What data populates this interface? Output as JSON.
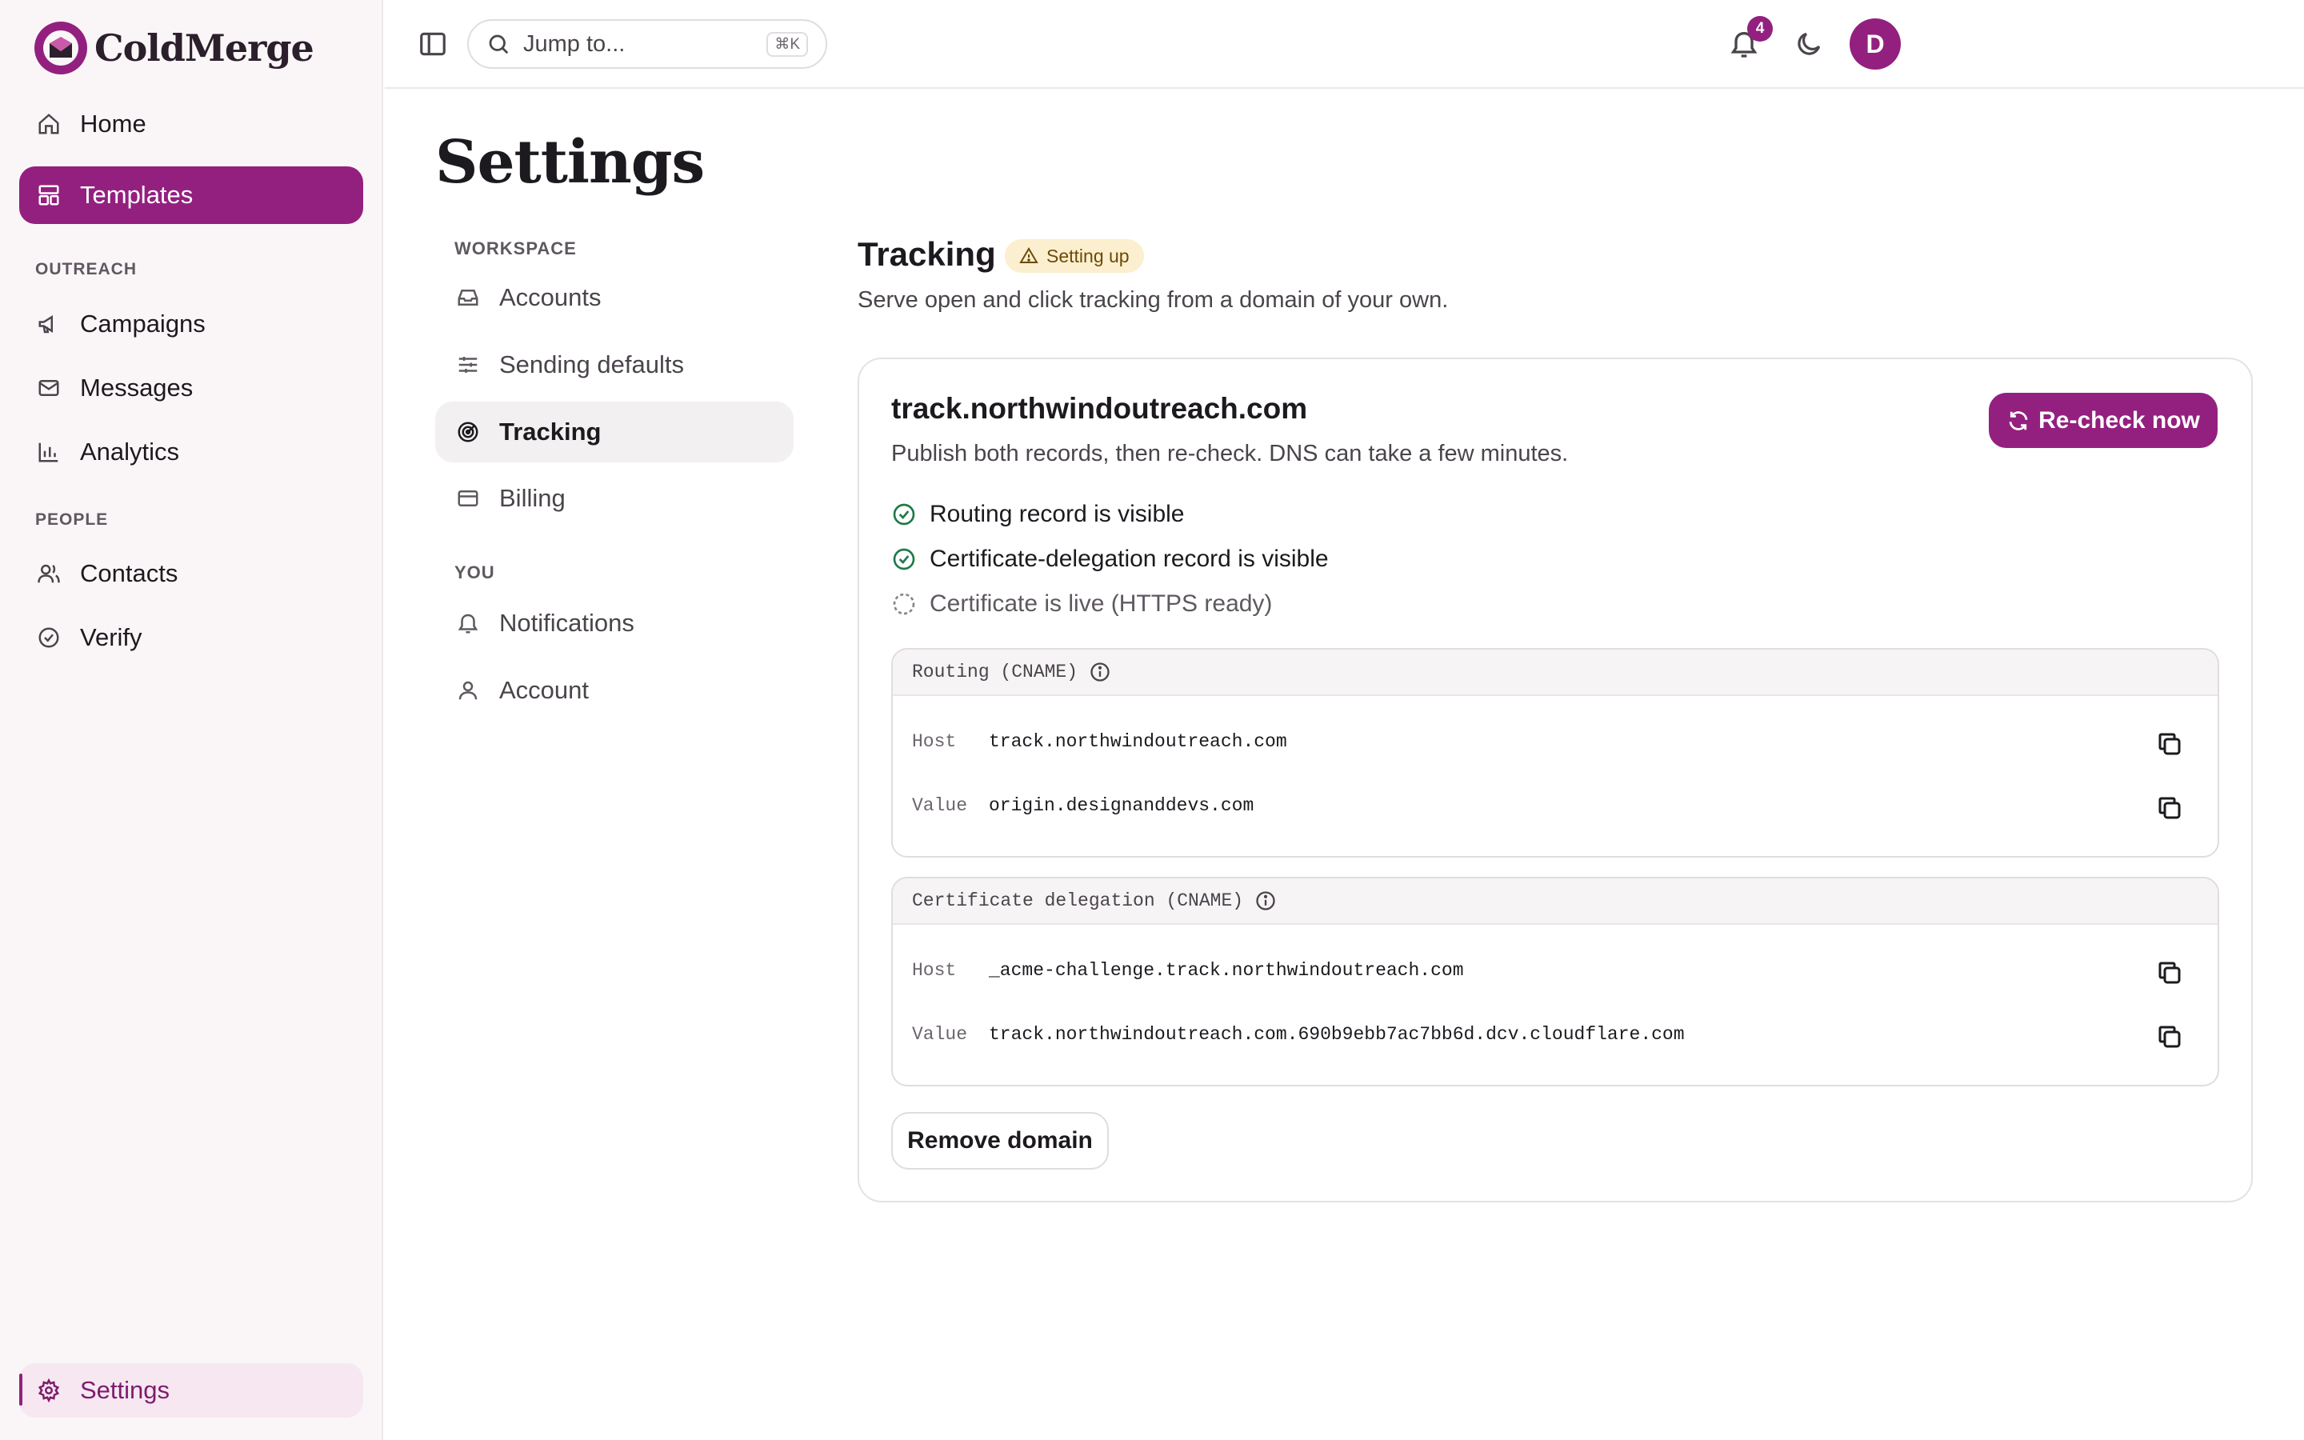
{
  "brand": {
    "name": "ColdMerge"
  },
  "sidebar": {
    "items": [
      {
        "label": "Home",
        "icon": "home-icon"
      },
      {
        "label": "Templates",
        "icon": "templates-icon"
      }
    ],
    "outreach_label": "OUTREACH",
    "outreach": [
      {
        "label": "Campaigns",
        "icon": "megaphone-icon"
      },
      {
        "label": "Messages",
        "icon": "mail-icon"
      },
      {
        "label": "Analytics",
        "icon": "bar-chart-icon"
      }
    ],
    "people_label": "PEOPLE",
    "people": [
      {
        "label": "Contacts",
        "icon": "users-icon"
      },
      {
        "label": "Verify",
        "icon": "check-circle-icon"
      }
    ],
    "settings": {
      "label": "Settings",
      "icon": "gear-icon"
    }
  },
  "topbar": {
    "search_placeholder": "Jump to...",
    "search_shortcut": "⌘K",
    "notifications_count": "4",
    "avatar_initial": "D"
  },
  "page": {
    "title": "Settings"
  },
  "settings_nav": {
    "workspace_label": "WORKSPACE",
    "workspace": [
      "Accounts",
      "Sending defaults",
      "Tracking",
      "Billing"
    ],
    "you_label": "YOU",
    "you": [
      "Notifications",
      "Account"
    ]
  },
  "tracking": {
    "title": "Tracking",
    "status": "Setting up",
    "description": "Serve open and click tracking from a domain of your own.",
    "domain": "track.northwindoutreach.com",
    "domain_desc": "Publish both records, then re-check. DNS can take a few minutes.",
    "recheck_label": "Re-check now",
    "checks": [
      {
        "label": "Routing record is visible",
        "state": "done"
      },
      {
        "label": "Certificate-delegation record is visible",
        "state": "done"
      },
      {
        "label": "Certificate is live (HTTPS ready)",
        "state": "pending"
      }
    ],
    "records": [
      {
        "title": "Routing (CNAME)",
        "host_label": "Host",
        "host": "track.northwindoutreach.com",
        "value_label": "Value",
        "value": "origin.designanddevs.com"
      },
      {
        "title": "Certificate delegation (CNAME)",
        "host_label": "Host",
        "host": "_acme-challenge.track.northwindoutreach.com",
        "value_label": "Value",
        "value": "track.northwindoutreach.com.690b9ebb7ac7bb6d.dcv.cloudflare.com"
      }
    ],
    "remove_label": "Remove domain"
  },
  "colors": {
    "accent": "#93207f",
    "badge_bg": "#fcefcf",
    "success": "#1f7a4a"
  }
}
